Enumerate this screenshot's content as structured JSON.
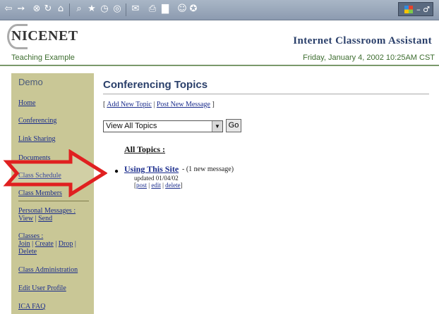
{
  "toolbar": {
    "icons": [
      "back-arrow-icon",
      "forward-arrow-icon",
      "stop-icon",
      "refresh-icon",
      "home-icon",
      "search-icon",
      "favorites-icon",
      "history-icon",
      "channels-icon",
      "fullscreen-icon",
      "mail-icon",
      "print-icon",
      "edit-icon",
      "discuss-icon",
      "messenger-icon"
    ],
    "window_controls": "– ♂"
  },
  "header": {
    "logo": "NICENET",
    "app_title": "Internet Classroom Assistant",
    "course": "Teaching Example",
    "date": "Friday, January 4, 2002 10:25AM CST"
  },
  "sidebar": {
    "title": "Demo",
    "items": [
      {
        "label": "Home"
      },
      {
        "label": "Conferencing"
      },
      {
        "label": "Link Sharing"
      },
      {
        "label": "Documents"
      },
      {
        "label": "Class Schedule"
      },
      {
        "label": "Class Members"
      }
    ],
    "personal_messages": {
      "label": "Personal Messages :",
      "view": "View",
      "send": "Send"
    },
    "classes": {
      "label": "Classes :",
      "join": "Join",
      "create": "Create",
      "drop": "Drop",
      "delete": "Delete"
    },
    "tail_items": [
      {
        "label": "Class Administration"
      },
      {
        "label": "Edit User Profile"
      },
      {
        "label": "ICA FAQ"
      }
    ]
  },
  "main": {
    "title": "Conferencing Topics",
    "actions": {
      "add": "Add New Topic",
      "post": "Post New Message"
    },
    "filter": {
      "selected": "View All Topics",
      "go_label": "Go"
    },
    "section_heading": "All Topics :",
    "topics": [
      {
        "title": "Using This Site",
        "meta": "(1 new message)",
        "updated": "updated 01/04/02",
        "actions": [
          "post",
          "edit",
          "delete"
        ]
      }
    ]
  },
  "colors": {
    "accent": "#2a3f6a",
    "sidebar": "#c9c796",
    "arrow": "#e02020",
    "link": "#1a2c8c"
  }
}
